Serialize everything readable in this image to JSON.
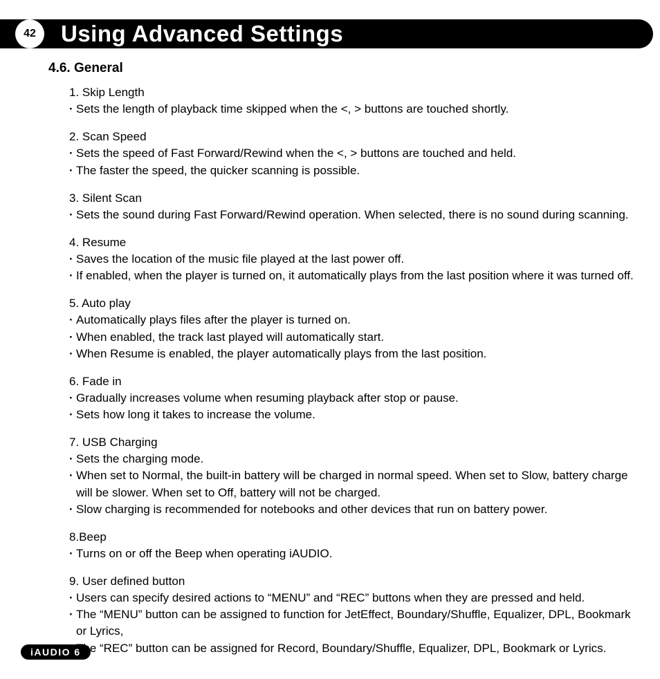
{
  "page_number": "42",
  "chapter_title": "Using Advanced Settings",
  "section_heading": "4.6. General",
  "items": [
    {
      "title": "1. Skip Length",
      "bullets": [
        "Sets the length of playback time skipped when the <, > buttons are touched shortly."
      ]
    },
    {
      "title": "2. Scan Speed",
      "bullets": [
        "Sets the speed of Fast Forward/Rewind when the <, > buttons are touched and held.",
        "The faster the speed, the quicker scanning is possible."
      ]
    },
    {
      "title": "3. Silent Scan",
      "bullets": [
        "Sets the sound during Fast Forward/Rewind operation. When selected, there is no sound during scanning."
      ]
    },
    {
      "title": "4. Resume",
      "bullets": [
        "Saves the location of the music file played at the last power off.",
        "If enabled, when the player is turned on, it automatically plays from the last position where it was turned off."
      ]
    },
    {
      "title": "5. Auto play",
      "bullets": [
        "Automatically plays files after the player is turned on.",
        "When enabled, the track last played will automatically start.",
        "When Resume is enabled, the player automatically plays from the last position."
      ]
    },
    {
      "title": "6. Fade in",
      "bullets": [
        "Gradually increases volume when resuming playback after stop or pause.",
        "Sets how long it takes to increase the volume."
      ]
    },
    {
      "title": "7. USB Charging",
      "bullets": [
        "Sets the charging mode.",
        "When set to Normal, the built-in battery will be charged in normal speed. When set to Slow, battery charge will be slower. When set to Off, battery will not be charged.",
        "Slow charging is recommended for notebooks and other devices that run on battery power."
      ]
    },
    {
      "title": "8.Beep",
      "bullets": [
        "Turns on or off the Beep when operating iAUDIO."
      ]
    },
    {
      "title": "9. User defined button",
      "bullets": [
        "Users can specify desired actions to “MENU” and “REC” buttons when they are pressed and held.",
        "The “MENU” button can be assigned to function for JetEffect, Boundary/Shuffle, Equalizer, DPL, Bookmark or Lyrics,",
        "The “REC” button can be assigned for Record, Boundary/Shuffle, Equalizer, DPL, Bookmark or Lyrics."
      ]
    }
  ],
  "footer_badge": "iAUDIO 6"
}
